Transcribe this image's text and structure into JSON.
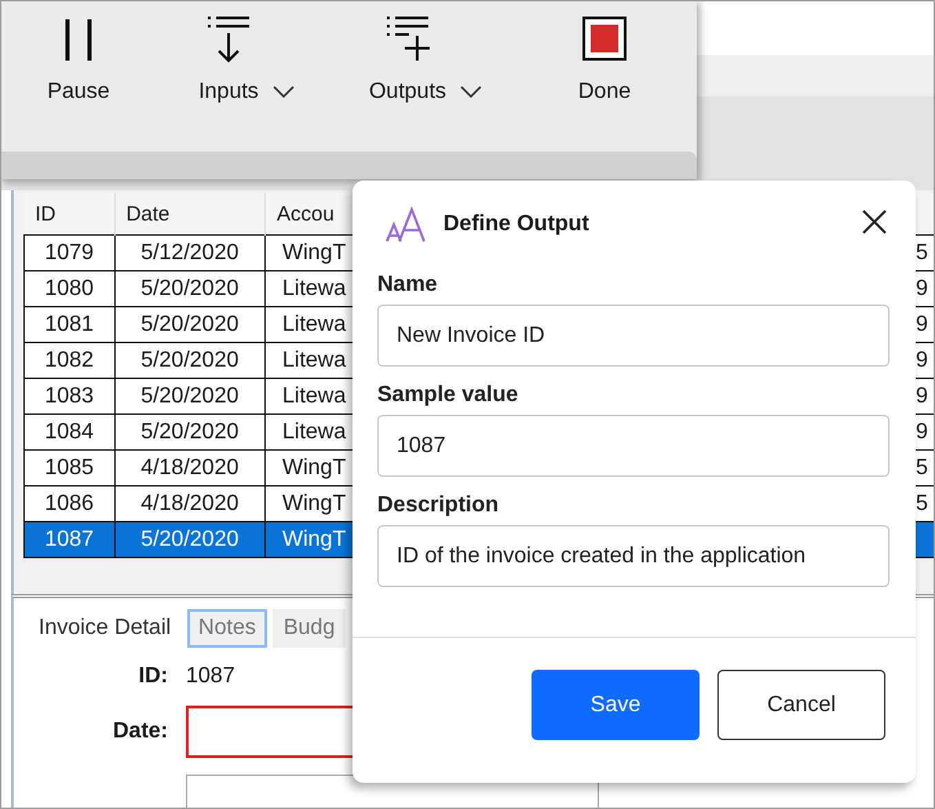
{
  "toolbar": {
    "buttons": [
      {
        "label": "Pause",
        "kind": "pause",
        "dropdown": false
      },
      {
        "label": "Inputs",
        "kind": "inputs",
        "dropdown": true
      },
      {
        "label": "Outputs",
        "kind": "outputs",
        "dropdown": true
      },
      {
        "label": "Done",
        "kind": "stop",
        "dropdown": false
      }
    ]
  },
  "table": {
    "columns": [
      "ID",
      "Date",
      "Accou"
    ],
    "rows": [
      {
        "cells": [
          "1079",
          "5/12/2020",
          "WingT",
          "5"
        ],
        "selected": false
      },
      {
        "cells": [
          "1080",
          "5/20/2020",
          "Litewa",
          "9"
        ],
        "selected": false
      },
      {
        "cells": [
          "1081",
          "5/20/2020",
          "Litewa",
          "9"
        ],
        "selected": false
      },
      {
        "cells": [
          "1082",
          "5/20/2020",
          "Litewa",
          "9"
        ],
        "selected": false
      },
      {
        "cells": [
          "1083",
          "5/20/2020",
          "Litewa",
          "9"
        ],
        "selected": false
      },
      {
        "cells": [
          "1084",
          "5/20/2020",
          "Litewa",
          "9"
        ],
        "selected": false
      },
      {
        "cells": [
          "1085",
          "4/18/2020",
          "WingT",
          "5"
        ],
        "selected": false
      },
      {
        "cells": [
          "1086",
          "4/18/2020",
          "WingT",
          "5"
        ],
        "selected": false
      },
      {
        "cells": [
          "1087",
          "5/20/2020",
          "WingT"
        ],
        "selected": true
      }
    ]
  },
  "detail_tabs": [
    {
      "label": "Invoice Detail",
      "selected": true,
      "focused": false
    },
    {
      "label": "Notes",
      "selected": false,
      "focused": true
    },
    {
      "label": "Budg",
      "selected": false,
      "focused": false
    }
  ],
  "detail_fields": [
    {
      "kind": "text",
      "label": "ID:",
      "value": "1087"
    },
    {
      "kind": "field",
      "label": "Date:",
      "invalid": true
    },
    {
      "kind": "field",
      "invalid": false
    }
  ],
  "dialog": {
    "title": "Define Output",
    "fields": [
      {
        "label": "Name",
        "value": "New Invoice ID"
      },
      {
        "label": "Sample value",
        "value": "1087"
      },
      {
        "label": "Description",
        "value": "ID of the invoice created in the application"
      }
    ],
    "buttons": [
      {
        "label": "Save",
        "primary": true
      },
      {
        "label": "Cancel",
        "primary": false
      }
    ]
  }
}
